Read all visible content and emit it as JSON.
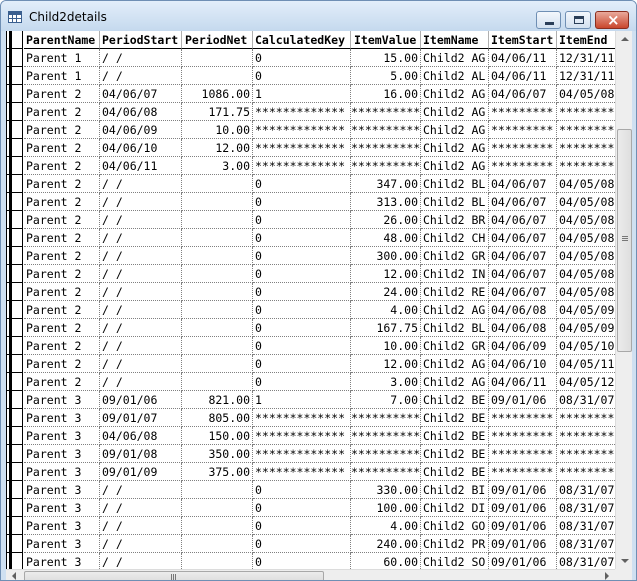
{
  "window": {
    "title": "Child2details"
  },
  "columns": [
    "ParentName",
    "PeriodStart",
    "PeriodNet",
    "CalculatedKey",
    "ItemValue",
    "ItemName",
    "ItemStart",
    "ItemEnd"
  ],
  "rows": [
    [
      "Parent 1",
      "/  /",
      "",
      "0",
      "15.00",
      "Child2 AG",
      "04/06/11",
      "12/31/11"
    ],
    [
      "Parent 1",
      "/  /",
      "",
      "0",
      "5.00",
      "Child2 AL",
      "04/06/11",
      "12/31/11"
    ],
    [
      "Parent 2",
      "04/06/07",
      "1086.00",
      "1",
      "16.00",
      "Child2 AG",
      "04/06/07",
      "04/05/08"
    ],
    [
      "Parent 2",
      "04/06/08",
      "171.75",
      "*************",
      "***********",
      "Child2 AG",
      "*********",
      "*********"
    ],
    [
      "Parent 2",
      "04/06/09",
      "10.00",
      "*************",
      "***********",
      "Child2 AG",
      "*********",
      "*********"
    ],
    [
      "Parent 2",
      "04/06/10",
      "12.00",
      "*************",
      "***********",
      "Child2 AG",
      "*********",
      "*********"
    ],
    [
      "Parent 2",
      "04/06/11",
      "3.00",
      "*************",
      "***********",
      "Child2 AG",
      "*********",
      "*********"
    ],
    [
      "Parent 2",
      "/  /",
      "",
      "0",
      "347.00",
      "Child2 BL",
      "04/06/07",
      "04/05/08"
    ],
    [
      "Parent 2",
      "/  /",
      "",
      "0",
      "313.00",
      "Child2 BL",
      "04/06/07",
      "04/05/08"
    ],
    [
      "Parent 2",
      "/  /",
      "",
      "0",
      "26.00",
      "Child2 BR",
      "04/06/07",
      "04/05/08"
    ],
    [
      "Parent 2",
      "/  /",
      "",
      "0",
      "48.00",
      "Child2 CH",
      "04/06/07",
      "04/05/08"
    ],
    [
      "Parent 2",
      "/  /",
      "",
      "0",
      "300.00",
      "Child2 GR",
      "04/06/07",
      "04/05/08"
    ],
    [
      "Parent 2",
      "/  /",
      "",
      "0",
      "12.00",
      "Child2 IN",
      "04/06/07",
      "04/05/08"
    ],
    [
      "Parent 2",
      "/  /",
      "",
      "0",
      "24.00",
      "Child2 RE",
      "04/06/07",
      "04/05/08"
    ],
    [
      "Parent 2",
      "/  /",
      "",
      "0",
      "4.00",
      "Child2 AG",
      "04/06/08",
      "04/05/09"
    ],
    [
      "Parent 2",
      "/  /",
      "",
      "0",
      "167.75",
      "Child2 BL",
      "04/06/08",
      "04/05/09"
    ],
    [
      "Parent 2",
      "/  /",
      "",
      "0",
      "10.00",
      "Child2 GR",
      "04/06/09",
      "04/05/10"
    ],
    [
      "Parent 2",
      "/  /",
      "",
      "0",
      "12.00",
      "Child2 AG",
      "04/06/10",
      "04/05/11"
    ],
    [
      "Parent 2",
      "/  /",
      "",
      "0",
      "3.00",
      "Child2 AG",
      "04/06/11",
      "04/05/12"
    ],
    [
      "Parent 3",
      "09/01/06",
      "821.00",
      "1",
      "7.00",
      "Child2 BE",
      "09/01/06",
      "08/31/07"
    ],
    [
      "Parent 3",
      "09/01/07",
      "805.00",
      "*************",
      "***********",
      "Child2 BE",
      "*********",
      "*********"
    ],
    [
      "Parent 3",
      "04/06/08",
      "150.00",
      "*************",
      "***********",
      "Child2 BE",
      "*********",
      "*********"
    ],
    [
      "Parent 3",
      "09/01/08",
      "350.00",
      "*************",
      "***********",
      "Child2 BE",
      "*********",
      "*********"
    ],
    [
      "Parent 3",
      "09/01/09",
      "375.00",
      "*************",
      "***********",
      "Child2 BE",
      "*********",
      "*********"
    ],
    [
      "Parent 3",
      "/  /",
      "",
      "0",
      "330.00",
      "Child2 BI",
      "09/01/06",
      "08/31/07"
    ],
    [
      "Parent 3",
      "/  /",
      "",
      "0",
      "100.00",
      "Child2 DI",
      "09/01/06",
      "08/31/07"
    ],
    [
      "Parent 3",
      "/  /",
      "",
      "0",
      "4.00",
      "Child2 GO",
      "09/01/06",
      "08/31/07"
    ],
    [
      "Parent 3",
      "/  /",
      "",
      "0",
      "240.00",
      "Child2 PR",
      "09/01/06",
      "08/31/07"
    ],
    [
      "Parent 3",
      "/  /",
      "",
      "0",
      "60.00",
      "Child2 SO",
      "09/01/06",
      "08/31/07"
    ]
  ],
  "icons": {
    "app": "table-icon",
    "minimize": "minimize-icon",
    "maximize": "maximize-icon",
    "close": "close-icon"
  }
}
